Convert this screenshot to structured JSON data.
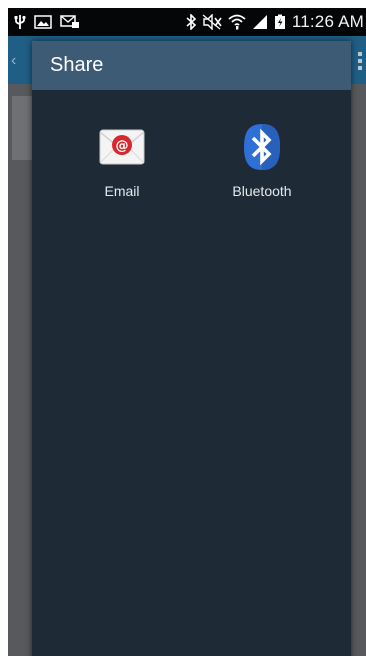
{
  "status_bar": {
    "time": "11:26 AM",
    "left_icons": [
      "usb-icon",
      "gallery-icon",
      "message-icon"
    ],
    "right_icons": [
      "bluetooth-icon",
      "mute-icon",
      "wifi-icon",
      "signal-icon",
      "battery-icon"
    ]
  },
  "background_app": {
    "action_bar_color": "#1f5f86",
    "icons": [
      "back-icon",
      "more-options-icon"
    ]
  },
  "dialog": {
    "title": "Share",
    "header_color": "#3e5b76",
    "background_color": "#1e2b37",
    "options": [
      {
        "label": "Email",
        "icon": "email-icon"
      },
      {
        "label": "Bluetooth",
        "icon": "bluetooth-icon"
      }
    ]
  }
}
